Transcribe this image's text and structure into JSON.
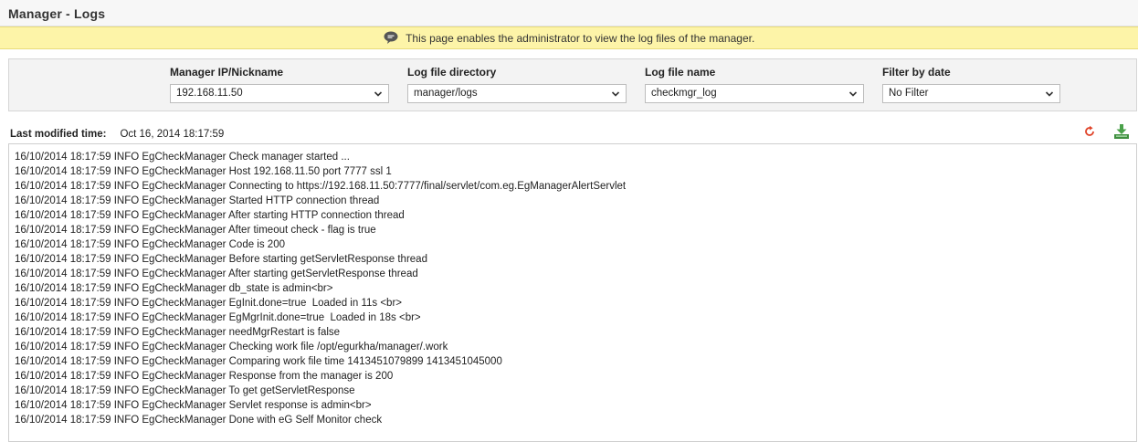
{
  "header": {
    "title": "Manager - Logs"
  },
  "info": {
    "icon": "speech-bubble-icon",
    "message": "This page enables the administrator to view the log files of the manager."
  },
  "filters": {
    "manager": {
      "label": "Manager IP/Nickname",
      "value": "192.168.11.50"
    },
    "directory": {
      "label": "Log file directory",
      "value": "manager/logs"
    },
    "filename": {
      "label": "Log file name",
      "value": "checkmgr_log"
    },
    "date": {
      "label": "Filter by date",
      "value": "No Filter"
    }
  },
  "last_modified": {
    "label": "Last modified time:",
    "value": "Oct 16, 2014 18:17:59"
  },
  "toolbar": {
    "refresh_icon": "refresh-icon",
    "download_icon": "download-icon"
  },
  "colors": {
    "info_bg": "#fdf4a8",
    "refresh": "#e0452b",
    "download": "#4aa14a"
  },
  "log": {
    "lines": [
      "16/10/2014 18:17:59 INFO EgCheckManager Check manager started ...",
      "16/10/2014 18:17:59 INFO EgCheckManager Host 192.168.11.50 port 7777 ssl 1",
      "16/10/2014 18:17:59 INFO EgCheckManager Connecting to https://192.168.11.50:7777/final/servlet/com.eg.EgManagerAlertServlet",
      "16/10/2014 18:17:59 INFO EgCheckManager Started HTTP connection thread",
      "16/10/2014 18:17:59 INFO EgCheckManager After starting HTTP connection thread",
      "16/10/2014 18:17:59 INFO EgCheckManager After timeout check - flag is true",
      "16/10/2014 18:17:59 INFO EgCheckManager Code is 200",
      "16/10/2014 18:17:59 INFO EgCheckManager Before starting getServletResponse thread",
      "16/10/2014 18:17:59 INFO EgCheckManager After starting getServletResponse thread",
      "16/10/2014 18:17:59 INFO EgCheckManager db_state is admin<br>",
      "16/10/2014 18:17:59 INFO EgCheckManager EgInit.done=true  Loaded in 11s <br>",
      "16/10/2014 18:17:59 INFO EgCheckManager EgMgrInit.done=true  Loaded in 18s <br>",
      "16/10/2014 18:17:59 INFO EgCheckManager needMgrRestart is false",
      "16/10/2014 18:17:59 INFO EgCheckManager Checking work file /opt/egurkha/manager/.work",
      "16/10/2014 18:17:59 INFO EgCheckManager Comparing work file time 1413451079899 1413451045000",
      "16/10/2014 18:17:59 INFO EgCheckManager Response from the manager is 200",
      "16/10/2014 18:17:59 INFO EgCheckManager To get getServletResponse",
      "16/10/2014 18:17:59 INFO EgCheckManager Servlet response is admin<br>",
      "16/10/2014 18:17:59 INFO EgCheckManager Done with eG Self Monitor check"
    ]
  }
}
